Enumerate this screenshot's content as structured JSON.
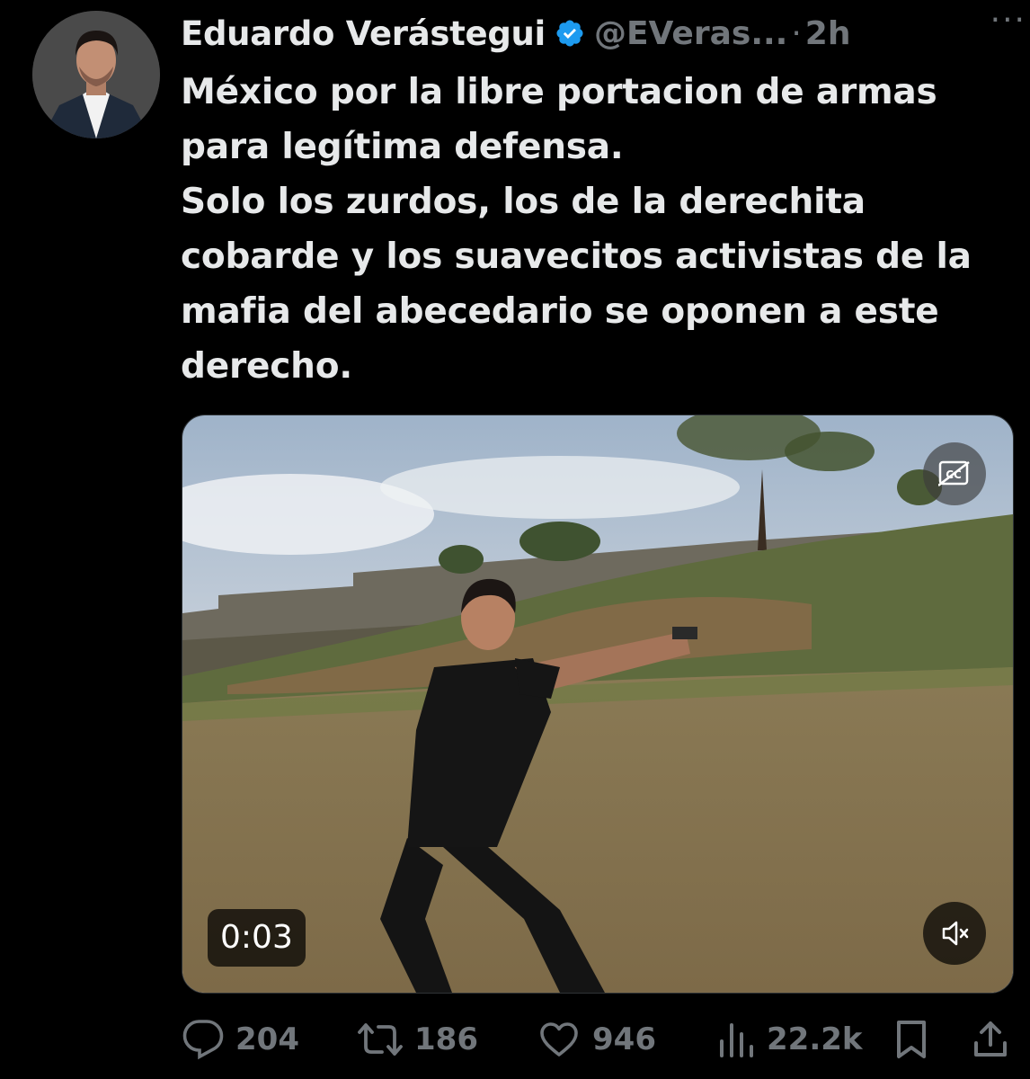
{
  "tweet": {
    "author": {
      "display_name": "Eduardo Verástegui",
      "handle": "@EVeras...",
      "verified_icon": "verified-badge-icon",
      "avatar_icon": "avatar"
    },
    "separator": "·",
    "time": "2h",
    "more_label": "···",
    "text": "México por la libre portacion de armas\npara legítima defensa.\nSolo los zurdos, los de la derechita\ncobarde y los suavecitos activistas de la\nmafia del abecedario se oponen a este\nderecho.",
    "media": {
      "type": "video",
      "duration": "0:03",
      "cc_icon": "closed-captions-icon",
      "mute_icon": "muted-speaker-icon"
    },
    "actions": {
      "replies": "204",
      "reposts": "186",
      "likes": "946",
      "views": "22.2k"
    },
    "colors": {
      "background": "#000000",
      "text": "#e7e9ea",
      "secondary": "#71767b",
      "verified": "#1d9bf0"
    }
  }
}
